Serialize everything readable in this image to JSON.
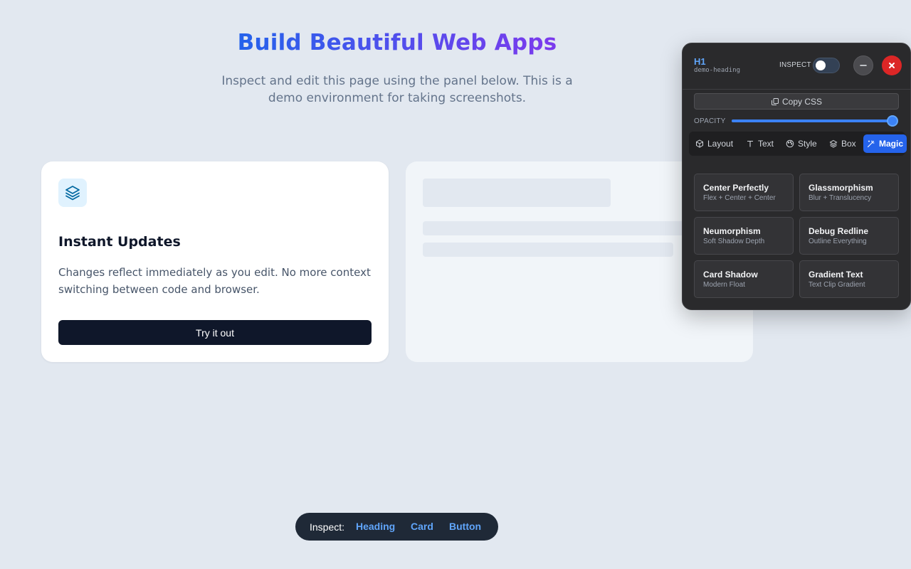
{
  "hero": {
    "title": "Build Beautiful Web Apps",
    "subtitle": "Inspect and edit this page using the panel below. This is a demo environment for taking screenshots."
  },
  "card": {
    "icon": "layers-icon",
    "title": "Instant Updates",
    "text": "Changes reflect immediately as you edit. No more context switching between code and browser.",
    "button_label": "Try it out"
  },
  "panel": {
    "element_tag": "H1",
    "element_id": "demo-heading",
    "inspect_label": "INSPECT",
    "inspect_enabled": false,
    "copy_css_label": "Copy CSS",
    "opacity_label": "OPACITY",
    "opacity_value": 1.0,
    "tabs": [
      {
        "label": "Layout",
        "icon": "cube-icon",
        "active": false
      },
      {
        "label": "Text",
        "icon": "type-icon",
        "active": false
      },
      {
        "label": "Style",
        "icon": "palette-icon",
        "active": false
      },
      {
        "label": "Box",
        "icon": "layers-icon",
        "active": false
      },
      {
        "label": "Magic",
        "icon": "magic-wand-icon",
        "active": true
      }
    ],
    "magic_items": [
      {
        "title": "Center Perfectly",
        "subtitle": "Flex + Center + Center"
      },
      {
        "title": "Glassmorphism",
        "subtitle": "Blur + Translucency"
      },
      {
        "title": "Neumorphism",
        "subtitle": "Soft Shadow Depth"
      },
      {
        "title": "Debug Redline",
        "subtitle": "Outline Everything"
      },
      {
        "title": "Card Shadow",
        "subtitle": "Modern Float"
      },
      {
        "title": "Gradient Text",
        "subtitle": "Text Clip Gradient"
      }
    ]
  },
  "inspect_bar": {
    "label": "Inspect:",
    "links": [
      "Heading",
      "Card",
      "Button"
    ]
  },
  "colors": {
    "background": "#e2e8f0",
    "accent": "#2563eb",
    "gradient_start": "#2563eb",
    "gradient_end": "#7c3aed",
    "close": "#dc2626"
  }
}
